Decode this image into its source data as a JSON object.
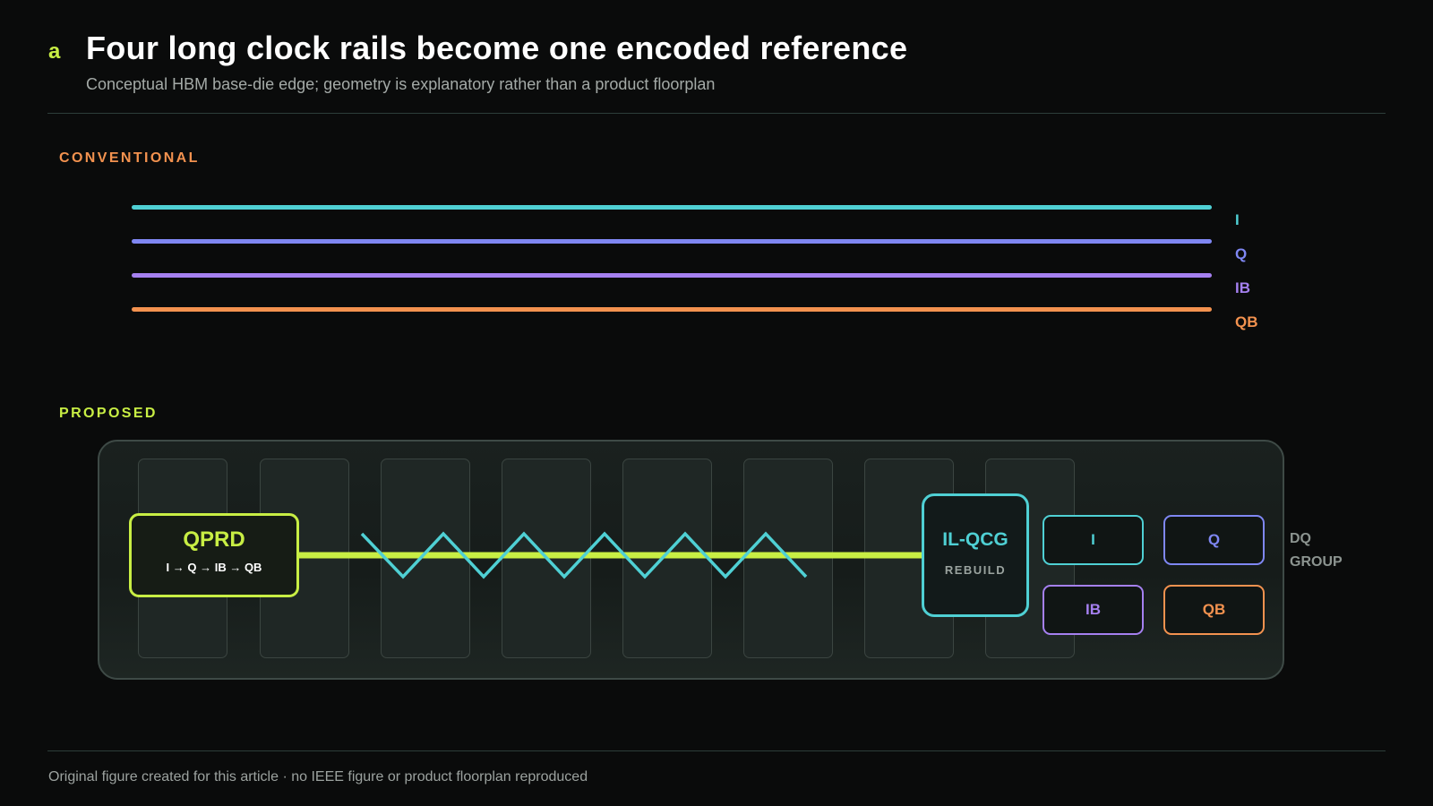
{
  "header": {
    "panel_letter": "a",
    "title": "Four long clock rails become one encoded reference",
    "subtitle": "Conceptual HBM base-die edge; geometry is explanatory rather than a product floorplan"
  },
  "conventional": {
    "label": "CONVENTIONAL",
    "rails": [
      {
        "label": "I",
        "color": "#4fd0d4"
      },
      {
        "label": "Q",
        "color": "#7f87f3"
      },
      {
        "label": "IB",
        "color": "#a580f0"
      },
      {
        "label": "QB",
        "color": "#f3924f"
      }
    ]
  },
  "proposed": {
    "label": "PROPOSED",
    "qprd": {
      "title": "QPRD",
      "sequence": "I → Q → IB → QB"
    },
    "ilqcg": {
      "title": "IL-QCG",
      "subtitle": "REBUILD"
    },
    "outputs": [
      {
        "label": "I",
        "color": "#4fd0d4"
      },
      {
        "label": "Q",
        "color": "#7f87f3"
      },
      {
        "label": "IB",
        "color": "#a580f0"
      },
      {
        "label": "QB",
        "color": "#f3924f"
      }
    ],
    "dq_label_line1": "DQ",
    "dq_label_line2": "GROUP"
  },
  "footer": "Original figure created for this article · no IEEE figure or product floorplan reproduced",
  "colors": {
    "accent_green": "#c8ee44",
    "accent_cyan": "#4fd0d4",
    "accent_orange": "#f3924f",
    "background": "#0a0b0b"
  }
}
